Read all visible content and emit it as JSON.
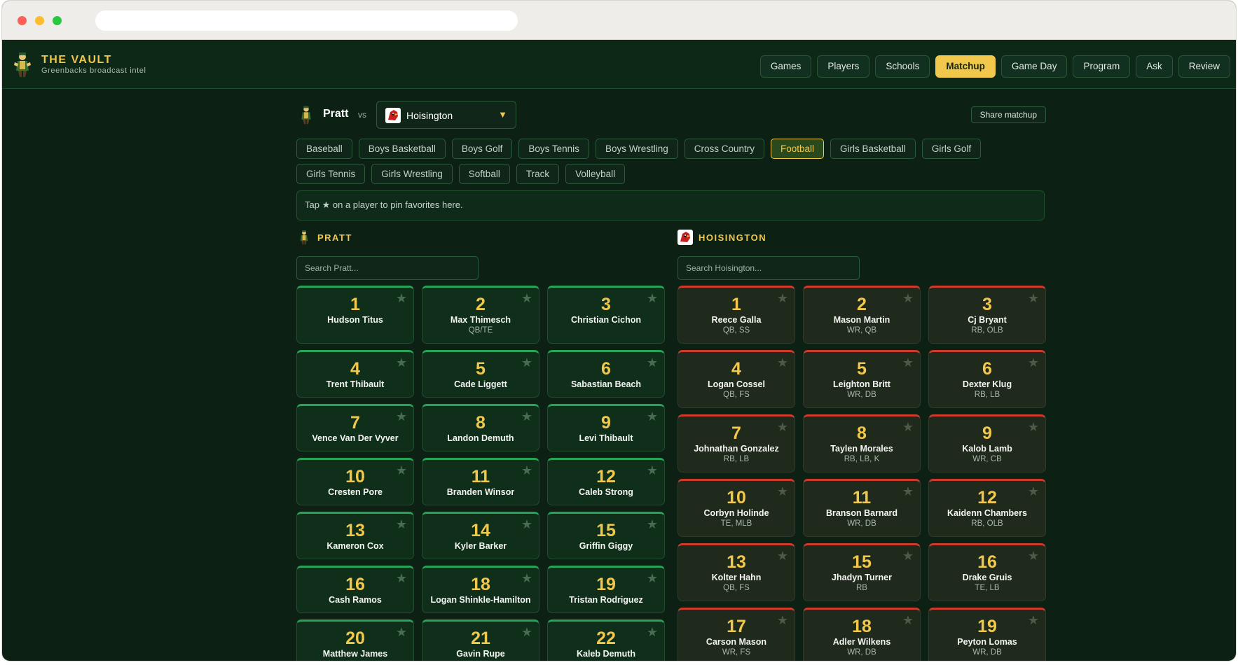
{
  "app": {
    "title": "THE VAULT",
    "subtitle": "Greenbacks broadcast intel"
  },
  "nav": [
    {
      "label": "Games",
      "active": false
    },
    {
      "label": "Players",
      "active": false
    },
    {
      "label": "Schools",
      "active": false
    },
    {
      "label": "Matchup",
      "active": true
    },
    {
      "label": "Game Day",
      "active": false
    },
    {
      "label": "Program",
      "active": false
    },
    {
      "label": "Ask",
      "active": false
    },
    {
      "label": "Review",
      "active": false
    }
  ],
  "matchup": {
    "home": "Pratt",
    "vs": "vs",
    "opponent": "Hoisington",
    "share_label": "Share matchup"
  },
  "sports": [
    {
      "label": "Baseball",
      "active": false
    },
    {
      "label": "Boys Basketball",
      "active": false
    },
    {
      "label": "Boys Golf",
      "active": false
    },
    {
      "label": "Boys Tennis",
      "active": false
    },
    {
      "label": "Boys Wrestling",
      "active": false
    },
    {
      "label": "Cross Country",
      "active": false
    },
    {
      "label": "Football",
      "active": true
    },
    {
      "label": "Girls Basketball",
      "active": false
    },
    {
      "label": "Girls Golf",
      "active": false
    },
    {
      "label": "Girls Tennis",
      "active": false
    },
    {
      "label": "Girls Wrestling",
      "active": false
    },
    {
      "label": "Softball",
      "active": false
    },
    {
      "label": "Track",
      "active": false
    },
    {
      "label": "Volleyball",
      "active": false
    }
  ],
  "pin_hint": {
    "before": "Tap",
    "star": "★",
    "after": "on a player to pin favorites here."
  },
  "teams": {
    "home": {
      "label": "PRATT",
      "search_placeholder": "Search Pratt...",
      "accent": "#28a457",
      "players": [
        {
          "number": "1",
          "name": "Hudson Titus",
          "pos": ""
        },
        {
          "number": "2",
          "name": "Max Thimesch",
          "pos": "QB/TE"
        },
        {
          "number": "3",
          "name": "Christian Cichon",
          "pos": ""
        },
        {
          "number": "4",
          "name": "Trent Thibault",
          "pos": ""
        },
        {
          "number": "5",
          "name": "Cade Liggett",
          "pos": ""
        },
        {
          "number": "6",
          "name": "Sabastian Beach",
          "pos": ""
        },
        {
          "number": "7",
          "name": "Vence Van Der Vyver",
          "pos": ""
        },
        {
          "number": "8",
          "name": "Landon Demuth",
          "pos": ""
        },
        {
          "number": "9",
          "name": "Levi Thibault",
          "pos": ""
        },
        {
          "number": "10",
          "name": "Cresten Pore",
          "pos": ""
        },
        {
          "number": "11",
          "name": "Branden Winsor",
          "pos": ""
        },
        {
          "number": "12",
          "name": "Caleb Strong",
          "pos": ""
        },
        {
          "number": "13",
          "name": "Kameron Cox",
          "pos": ""
        },
        {
          "number": "14",
          "name": "Kyler Barker",
          "pos": ""
        },
        {
          "number": "15",
          "name": "Griffin Giggy",
          "pos": ""
        },
        {
          "number": "16",
          "name": "Cash Ramos",
          "pos": ""
        },
        {
          "number": "18",
          "name": "Logan Shinkle-Hamilton",
          "pos": ""
        },
        {
          "number": "19",
          "name": "Tristan Rodriguez",
          "pos": ""
        },
        {
          "number": "20",
          "name": "Matthew James",
          "pos": ""
        },
        {
          "number": "21",
          "name": "Gavin Rupe",
          "pos": ""
        },
        {
          "number": "22",
          "name": "Kaleb Demuth",
          "pos": ""
        }
      ]
    },
    "away": {
      "label": "HOISINGTON",
      "search_placeholder": "Search Hoisington...",
      "accent": "#d03a2c",
      "players": [
        {
          "number": "1",
          "name": "Reece Galla",
          "pos": "QB, SS"
        },
        {
          "number": "2",
          "name": "Mason Martin",
          "pos": "WR, QB"
        },
        {
          "number": "3",
          "name": "Cj Bryant",
          "pos": "RB, OLB"
        },
        {
          "number": "4",
          "name": "Logan Cossel",
          "pos": "QB, FS"
        },
        {
          "number": "5",
          "name": "Leighton Britt",
          "pos": "WR, DB"
        },
        {
          "number": "6",
          "name": "Dexter Klug",
          "pos": "RB, LB"
        },
        {
          "number": "7",
          "name": "Johnathan Gonzalez",
          "pos": "RB, LB"
        },
        {
          "number": "8",
          "name": "Taylen Morales",
          "pos": "RB, LB, K"
        },
        {
          "number": "9",
          "name": "Kalob Lamb",
          "pos": "WR, CB"
        },
        {
          "number": "10",
          "name": "Corbyn Holinde",
          "pos": "TE, MLB"
        },
        {
          "number": "11",
          "name": "Branson Barnard",
          "pos": "WR, DB"
        },
        {
          "number": "12",
          "name": "Kaidenn Chambers",
          "pos": "RB, OLB"
        },
        {
          "number": "13",
          "name": "Kolter Hahn",
          "pos": "QB, FS"
        },
        {
          "number": "15",
          "name": "Jhadyn Turner",
          "pos": "RB"
        },
        {
          "number": "16",
          "name": "Drake Gruis",
          "pos": "TE, LB"
        },
        {
          "number": "17",
          "name": "Carson Mason",
          "pos": "WR, FS"
        },
        {
          "number": "18",
          "name": "Adler Wilkens",
          "pos": "WR, DB"
        },
        {
          "number": "19",
          "name": "Peyton Lomas",
          "pos": "WR, DB"
        }
      ]
    }
  },
  "colors": {
    "gold": "#f1c84b",
    "bg": "#0c2014",
    "home_accent": "#28a457",
    "away_accent": "#d03a2c"
  }
}
